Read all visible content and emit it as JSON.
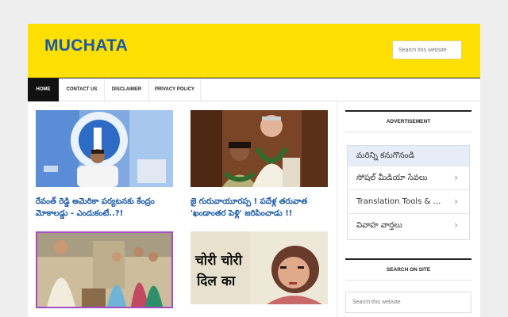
{
  "header": {
    "logo": "MUCHATA",
    "search_placeholder": "Search this website"
  },
  "nav": {
    "items": [
      "HOME",
      "CONTACT US",
      "DISCLAIMER",
      "PRIVACY POLICY"
    ]
  },
  "posts": [
    {
      "title_line1": "రేవంత్ రెడ్డి అమెరికా పర్యటనకు కేంద్రం",
      "title_line2": "మోకాలడ్డు - ఎందుకంటే..?!"
    },
    {
      "title_line1": "జై గురువాయూరప్ప ! పదేళ్ల తరువాత",
      "title_line2": "'ఖండాంతర పెళ్లి' జరిపించాడు !!"
    },
    {
      "thumb_text_line1": "चोरी चोरी",
      "thumb_text_line2": "दिल का"
    }
  ],
  "sidebar": {
    "advertisement": "ADVERTISEMENT",
    "menu_title": "మరిన్ని కనుగొనండి",
    "menu_items": [
      "సోషల్ మీడియా సేవలు",
      "Translation Tools & Resources",
      "వివాహ వార్తలు"
    ],
    "search_heading": "SEARCH ON SITE",
    "search_placeholder": "Search this website"
  },
  "colors": {
    "header_bg": "#fddf02",
    "brand_blue": "#1a5aa6"
  }
}
